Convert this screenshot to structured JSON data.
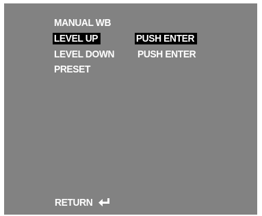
{
  "menu": {
    "title": "MANUAL WB",
    "items": [
      {
        "label": "LEVEL UP",
        "value": "PUSH ENTER",
        "selected": true
      },
      {
        "label": "LEVEL DOWN",
        "value": "PUSH ENTER",
        "selected": false
      },
      {
        "label": "PRESET",
        "value": "",
        "selected": false
      }
    ]
  },
  "footer": {
    "return_label": "RETURN",
    "return_icon": "enter-arrow-icon"
  },
  "colors": {
    "background": "#828282",
    "text": "#ffffff",
    "highlight": "#000000"
  }
}
